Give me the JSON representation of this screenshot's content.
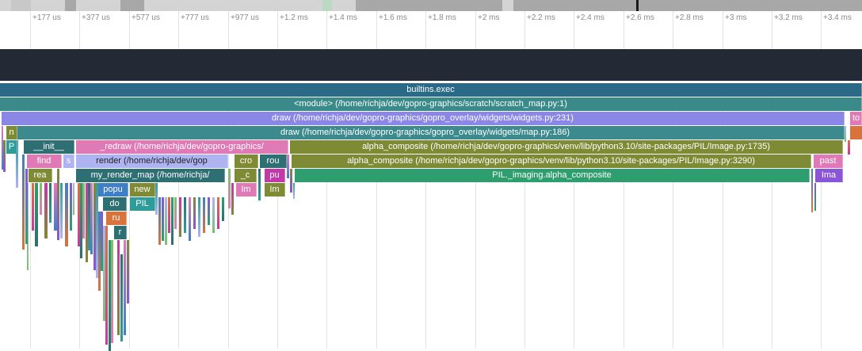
{
  "timeline": {
    "ticks": [
      "+177 us",
      "+377 us",
      "+577 us",
      "+777 us",
      "+977 us",
      "+1.2 ms",
      "+1.4 ms",
      "+1.6 ms",
      "+1.8 ms",
      "+2 ms",
      "+2.2 ms",
      "+2.4 ms",
      "+2.6 ms",
      "+2.8 ms",
      "+3 ms",
      "+3.2 ms",
      "+3.4 ms"
    ]
  },
  "frames": {
    "builtins_exec": "builtins.exec",
    "module": "<module> (/home/richja/dev/gopro-graphics/scratch/scratch_map.py:1)",
    "draw_widgets": "draw (/home/richja/dev/gopro-graphics/gopro_overlay/widgets/widgets.py:231)",
    "to_trunc": "to",
    "draw_map": "draw (/home/richja/dev/gopro-graphics/gopro_overlay/widgets/map.py:186)",
    "n": "n",
    "p": "P",
    "init": "__init__",
    "redraw": "_redraw (/home/richja/dev/gopro-graphics/",
    "alpha_composite_1735": "alpha_composite (/home/richja/dev/gopro-graphics/venv/lib/python3.10/site-packages/PIL/Image.py:1735)",
    "find": "find",
    "s": "s",
    "render": "render (/home/richja/dev/gop",
    "cro": "cro",
    "rou": "rou",
    "alpha_composite_3290": "alpha_composite (/home/richja/dev/gopro-graphics/venv/lib/python3.10/site-packages/PIL/Image.py:3290)",
    "past": "past",
    "rea": "rea",
    "my_render_map": "my_render_map (/home/richja/",
    "c": "_c",
    "pu": "pu",
    "pil_imaging": "PIL._imaging.alpha_composite",
    "ima_right": "Ima",
    "popu": "popu",
    "new": "new",
    "im_1": "Im",
    "im_2": "Im",
    "do": "do",
    "pil_small": "PIL",
    "ru": "ru",
    "r": "r"
  },
  "colors": {
    "builtins": "#2b6a87",
    "module": "#3a8a8a",
    "draw_widgets": "#8a87e6",
    "draw_map": "#3c8a8e",
    "olive": "#7f8a34",
    "pink": "#e07ab6",
    "lavender": "#aeb4f2",
    "green": "#2f9e6e",
    "blue": "#3f7fc6",
    "teal": "#2e9d9a",
    "darkteal": "#2e6f73",
    "orange": "#d9733c",
    "magenta": "#c23aa8",
    "purple": "#8a55d6",
    "lime": "#79c36b"
  }
}
